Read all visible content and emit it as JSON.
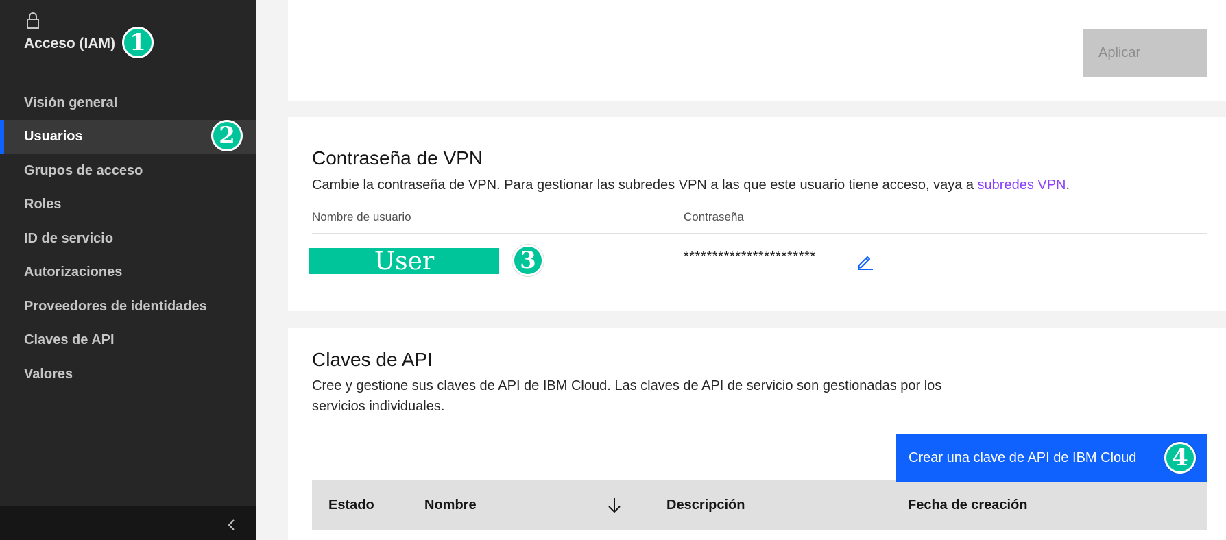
{
  "sidebar": {
    "title": "Acceso (IAM)",
    "items": [
      {
        "label": "Visión general"
      },
      {
        "label": "Usuarios",
        "active": true
      },
      {
        "label": "Grupos de acceso"
      },
      {
        "label": "Roles"
      },
      {
        "label": "ID de servicio"
      },
      {
        "label": "Autorizaciones"
      },
      {
        "label": "Proveedores de identidades"
      },
      {
        "label": "Claves de API"
      },
      {
        "label": "Valores"
      }
    ],
    "icons": {
      "title": "lock-icon",
      "footer": "chevron-left-icon"
    }
  },
  "callouts": [
    "1",
    "2",
    "3",
    "4"
  ],
  "top_card": {
    "apply_label": "Aplicar"
  },
  "vpn": {
    "title": "Contraseña de VPN",
    "desc_prefix": "Cambie la contraseña de VPN. Para gestionar las subredes VPN a las que este usuario tiene acceso, vaya a ",
    "desc_link": "subredes VPN",
    "desc_suffix": ".",
    "col_username": "Nombre de usuario",
    "col_password": "Contraseña",
    "username": "User",
    "password": "***********************"
  },
  "api_keys": {
    "title": "Claves de API",
    "desc_line1": "Cree y gestione sus claves de API de IBM Cloud. Las claves de API de servicio son gestionadas por los",
    "desc_line2": "servicios individuales.",
    "create_label": "Crear una clave de API de IBM Cloud",
    "columns": [
      "Estado",
      "Nombre",
      "Descripción",
      "Fecha de creación"
    ]
  },
  "colors": {
    "accent": "#0f62fe",
    "callout": "#00c49a",
    "link": "#8a3ffc",
    "sidebar_bg": "#262626"
  }
}
